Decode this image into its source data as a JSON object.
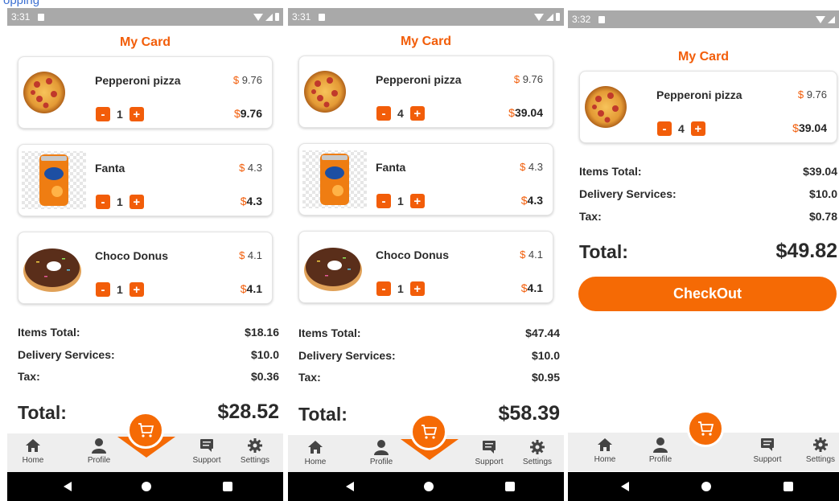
{
  "page_label": "opping",
  "colors": {
    "accent": "#f25d09",
    "status_bar": "#a9a9a9",
    "nav_bg": "#eeeeee"
  },
  "currency_symbol": "$",
  "qty_minus": "-",
  "qty_plus": "+",
  "title": "My Card",
  "summary_labels": {
    "items_total": "Items Total:",
    "delivery": "Delivery Services:",
    "tax": "Tax:",
    "total": "Total:"
  },
  "checkout_label": "CheckOut",
  "nav": [
    {
      "label": "Home",
      "icon": "home-icon"
    },
    {
      "label": "Profile",
      "icon": "person-icon"
    },
    {
      "label": "Support",
      "icon": "chat-icon"
    },
    {
      "label": "Settings",
      "icon": "gear-icon"
    }
  ],
  "screens": [
    {
      "time": "3:31",
      "items": [
        {
          "name": "Pepperoni pizza",
          "unit_price": "9.76",
          "qty": "1",
          "line_total": "9.76",
          "icon": "pizza-image"
        },
        {
          "name": "Fanta",
          "unit_price": "4.3",
          "qty": "1",
          "line_total": "4.3",
          "icon": "fanta-can-image"
        },
        {
          "name": "Choco Donus",
          "unit_price": "4.1",
          "qty": "1",
          "line_total": "4.1",
          "icon": "donut-image"
        }
      ],
      "items_total": "$18.16",
      "delivery": "$10.0",
      "tax": "$0.36",
      "total": "$28.52"
    },
    {
      "time": "3:31",
      "items": [
        {
          "name": "Pepperoni pizza",
          "unit_price": "9.76",
          "qty": "4",
          "line_total": "39.04",
          "icon": "pizza-image"
        },
        {
          "name": "Fanta",
          "unit_price": "4.3",
          "qty": "1",
          "line_total": "4.3",
          "icon": "fanta-can-image"
        },
        {
          "name": "Choco Donus",
          "unit_price": "4.1",
          "qty": "1",
          "line_total": "4.1",
          "icon": "donut-image"
        }
      ],
      "items_total": "$47.44",
      "delivery": "$10.0",
      "tax": "$0.95",
      "total": "$58.39"
    },
    {
      "time": "3:32",
      "items": [
        {
          "name": "Pepperoni pizza",
          "unit_price": "9.76",
          "qty": "4",
          "line_total": "39.04",
          "icon": "pizza-image"
        }
      ],
      "items_total": "$39.04",
      "delivery": "$10.0",
      "tax": "$0.78",
      "total": "$49.82"
    }
  ]
}
